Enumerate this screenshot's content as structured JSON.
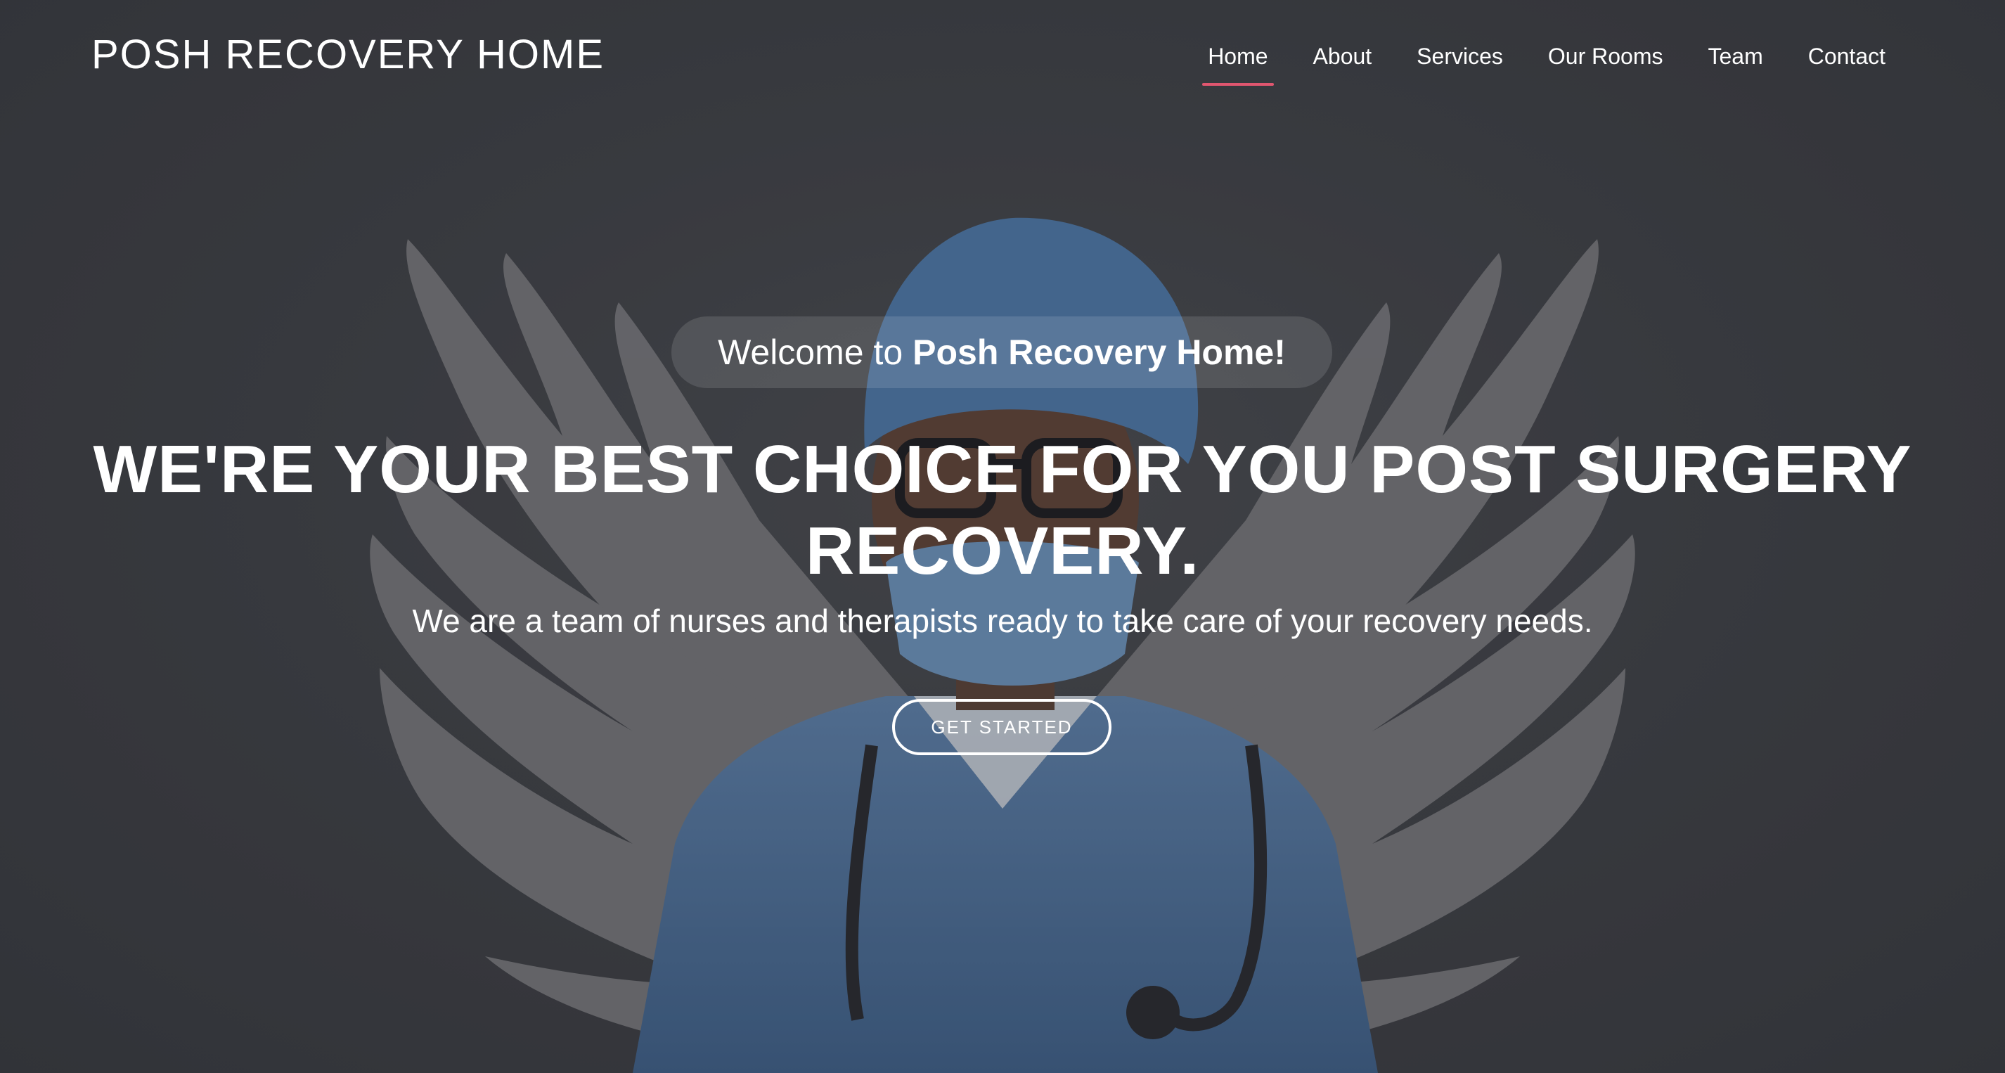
{
  "brand": {
    "name": "POSH RECOVERY HOME"
  },
  "nav": {
    "items": [
      {
        "label": "Home",
        "active": true
      },
      {
        "label": "About",
        "active": false
      },
      {
        "label": "Services",
        "active": false
      },
      {
        "label": "Our Rooms",
        "active": false
      },
      {
        "label": "Team",
        "active": false
      },
      {
        "label": "Contact",
        "active": false
      }
    ],
    "active_color": "#e0566f"
  },
  "hero": {
    "welcome_prefix": "Welcome to",
    "welcome_brand": "Posh Recovery Home!",
    "headline": "WE'RE YOUR BEST CHOICE FOR YOU POST SURGERY RECOVERY.",
    "subheading": "We are a team of nurses and therapists ready to take care of your recovery needs.",
    "cta_label": "GET STARTED"
  },
  "colors": {
    "background": "#3d3f44",
    "accent": "#e0566f",
    "scrubs_blue": "#5b7fa8"
  }
}
